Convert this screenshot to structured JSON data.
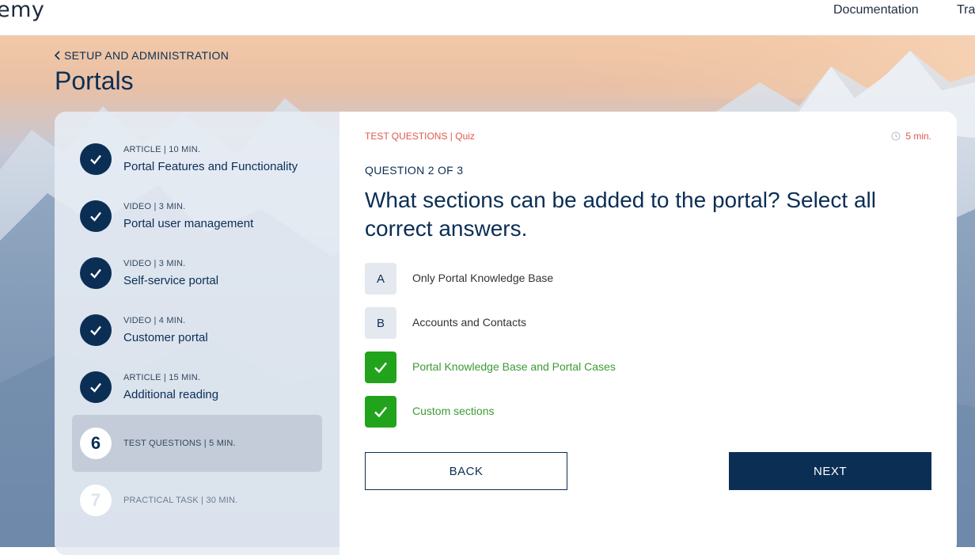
{
  "brand": {
    "logo_text": "emy"
  },
  "nav": {
    "documentation": "Documentation",
    "training": "Tra"
  },
  "breadcrumb": {
    "label": "SETUP AND ADMINISTRATION"
  },
  "page": {
    "title": "Portals"
  },
  "steps": [
    {
      "meta": "ARTICLE | 10 MIN.",
      "title": "Portal Features and Functionality",
      "status": "done"
    },
    {
      "meta": "VIDEO | 3 MIN.",
      "title": "Portal user management",
      "status": "done"
    },
    {
      "meta": "VIDEO | 3 MIN.",
      "title": "Self-service portal",
      "status": "done"
    },
    {
      "meta": "VIDEO | 4 MIN.",
      "title": "Customer portal",
      "status": "done"
    },
    {
      "meta": "ARTICLE | 15 MIN.",
      "title": "Additional reading",
      "status": "done"
    },
    {
      "number": "6",
      "meta": "TEST QUESTIONS | 5 MIN.",
      "status": "active"
    },
    {
      "number": "7",
      "meta": "PRACTICAL TASK | 30 MIN.",
      "status": "upcoming"
    }
  ],
  "quiz": {
    "tag": "TEST QUESTIONS | Quiz",
    "time": "5 min.",
    "question_number": "QUESTION 2 OF 3",
    "question": "What sections can be added to the portal? Select all correct answers.",
    "options": [
      {
        "letter": "A",
        "label": "Only Portal Knowledge Base",
        "checked": false
      },
      {
        "letter": "B",
        "label": "Accounts and Contacts",
        "checked": false
      },
      {
        "letter": "",
        "label": "Portal Knowledge Base and  Portal Cases",
        "checked": true
      },
      {
        "letter": "",
        "label": "Custom sections",
        "checked": true
      }
    ]
  },
  "buttons": {
    "back": "BACK",
    "next": "NEXT"
  },
  "colors": {
    "primary": "#0b2e55",
    "accent": "#e0584c",
    "success": "#22a31c"
  }
}
